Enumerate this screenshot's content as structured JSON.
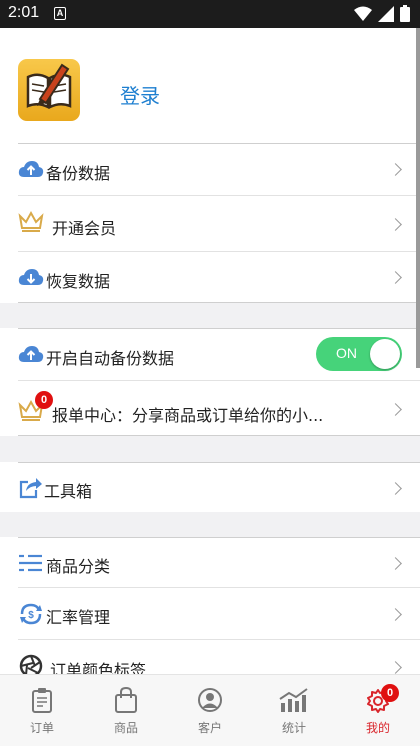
{
  "status_bar": {
    "time": "2:01",
    "notification": "A"
  },
  "header": {
    "login_label": "登录"
  },
  "menu_group_1": [
    {
      "label": "备份数据",
      "icon": "cloud-upload-icon"
    },
    {
      "label": "开通会员",
      "icon": "crown-icon"
    },
    {
      "label": "恢复数据",
      "icon": "cloud-download-icon"
    }
  ],
  "menu_group_2": {
    "auto_backup": {
      "label": "开启自动备份数据",
      "toggle_label": "ON",
      "enabled": true
    },
    "report_center": {
      "label": "报单中心：分享商品或订单给你的小...",
      "badge": "0"
    }
  },
  "menu_group_3": [
    {
      "label": "工具箱",
      "icon": "share-box-icon"
    }
  ],
  "menu_group_4": [
    {
      "label": "商品分类",
      "icon": "list-icon"
    },
    {
      "label": "汇率管理",
      "icon": "exchange-icon"
    },
    {
      "label": "订单颜色标签",
      "icon": "aperture-icon"
    }
  ],
  "tabbar": {
    "items": [
      {
        "label": "订单",
        "icon": "clipboard-icon"
      },
      {
        "label": "商品",
        "icon": "shopping-bag-icon"
      },
      {
        "label": "客户",
        "icon": "user-icon"
      },
      {
        "label": "统计",
        "icon": "chart-icon"
      },
      {
        "label": "我的",
        "icon": "settings-icon",
        "badge": "0",
        "active": true
      }
    ]
  },
  "colors": {
    "accent": "#1e7fd0",
    "toggle_on": "#46d37a",
    "tab_active": "#d9262c",
    "badge": "#e01010",
    "icon_blue": "#4a86d4"
  }
}
